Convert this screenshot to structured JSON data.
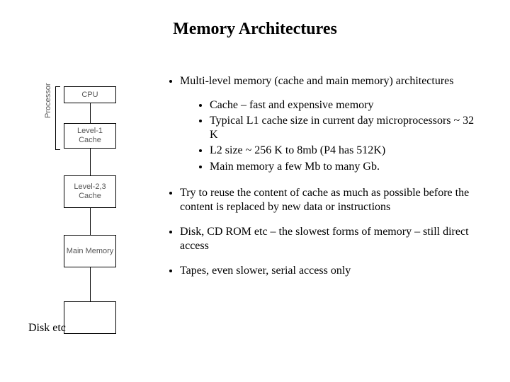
{
  "title": "Memory Architectures",
  "diagram": {
    "processor_label": "Processor",
    "boxes": {
      "cpu": "CPU",
      "l1": "Level-1\nCache",
      "l23": "Level-2,3\nCache",
      "main": "Main Memory",
      "disk": ""
    },
    "disk_caption": "Disk etc"
  },
  "bullets": {
    "b1": "Multi-level memory (cache and main memory) architectures",
    "sub": {
      "s1": "Cache – fast and expensive memory",
      "s2": "Typical L1 cache size in current day microprocessors ~ 32 K",
      "s3": "L2 size ~ 256 K to 8mb (P4 has 512K)",
      "s4": "Main memory a few Mb to many Gb."
    },
    "b2": "Try to reuse the content of cache as much as possible before the content is replaced by new data or instructions",
    "b3": "Disk, CD ROM etc – the slowest forms of memory – still direct access",
    "b4": "Tapes, even slower, serial access only"
  }
}
